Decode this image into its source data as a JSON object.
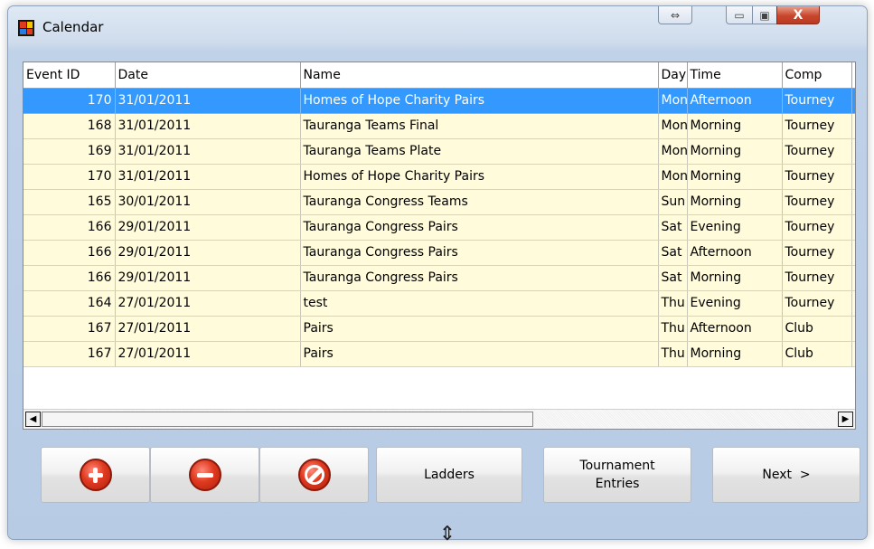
{
  "window": {
    "title": "Calendar",
    "caption_buttons": {
      "resize_symbol": "⇔",
      "minimize_symbol": "▭",
      "maximize_symbol": "▣",
      "close_symbol": "X"
    }
  },
  "table": {
    "columns": [
      "Event ID",
      "Date",
      "Name",
      "Day",
      "Time",
      "Comp",
      ""
    ],
    "rows": [
      {
        "event_id": "170",
        "date": "31/01/2011",
        "name": "Homes of Hope Charity Pairs",
        "day": "Mon",
        "time": "Afternoon",
        "comp": "Tourney",
        "extra": "",
        "selected": true
      },
      {
        "event_id": "168",
        "date": "31/01/2011",
        "name": "Tauranga Teams Final",
        "day": "Mon",
        "time": "Morning",
        "comp": "Tourney",
        "extra": ""
      },
      {
        "event_id": "169",
        "date": "31/01/2011",
        "name": "Tauranga Teams Plate",
        "day": "Mon",
        "time": "Morning",
        "comp": "Tourney",
        "extra": ""
      },
      {
        "event_id": "170",
        "date": "31/01/2011",
        "name": "Homes of Hope Charity Pairs",
        "day": "Mon",
        "time": "Morning",
        "comp": "Tourney",
        "extra": ""
      },
      {
        "event_id": "165",
        "date": "30/01/2011",
        "name": "Tauranga Congress Teams",
        "day": "Sun",
        "time": "Morning",
        "comp": "Tourney",
        "extra": ""
      },
      {
        "event_id": "166",
        "date": "29/01/2011",
        "name": "Tauranga Congress Pairs",
        "day": "Sat",
        "time": "Evening",
        "comp": "Tourney",
        "extra": ""
      },
      {
        "event_id": "166",
        "date": "29/01/2011",
        "name": "Tauranga Congress Pairs",
        "day": "Sat",
        "time": "Afternoon",
        "comp": "Tourney",
        "extra": ""
      },
      {
        "event_id": "166",
        "date": "29/01/2011",
        "name": "Tauranga Congress Pairs",
        "day": "Sat",
        "time": "Morning",
        "comp": "Tourney",
        "extra": ""
      },
      {
        "event_id": "164",
        "date": "27/01/2011",
        "name": "test",
        "day": "Thu",
        "time": "Evening",
        "comp": "Tourney",
        "extra": ""
      },
      {
        "event_id": "167",
        "date": "27/01/2011",
        "name": "Pairs",
        "day": "Thu",
        "time": "Afternoon",
        "comp": "Club",
        "extra": ""
      },
      {
        "event_id": "167",
        "date": "27/01/2011",
        "name": "Pairs",
        "day": "Thu",
        "time": "Morning",
        "comp": "Club",
        "extra": ""
      }
    ]
  },
  "scrollbar": {
    "left_arrow": "◀",
    "right_arrow": "▶"
  },
  "buttons": {
    "add_icon": "plus-circle-icon",
    "remove_icon": "minus-circle-icon",
    "edit_icon": "wrench-circle-icon",
    "ladders_label": "Ladders",
    "tournament_line1": "Tournament",
    "tournament_line2": "Entries",
    "next_label": "Next  >"
  },
  "resize_grip_symbol": "⇕",
  "colors": {
    "selected_row": "#3399ff",
    "row_background": "#fffbdb",
    "window_gradient": "#c0d2e8",
    "icon_red": "#e03a20"
  }
}
